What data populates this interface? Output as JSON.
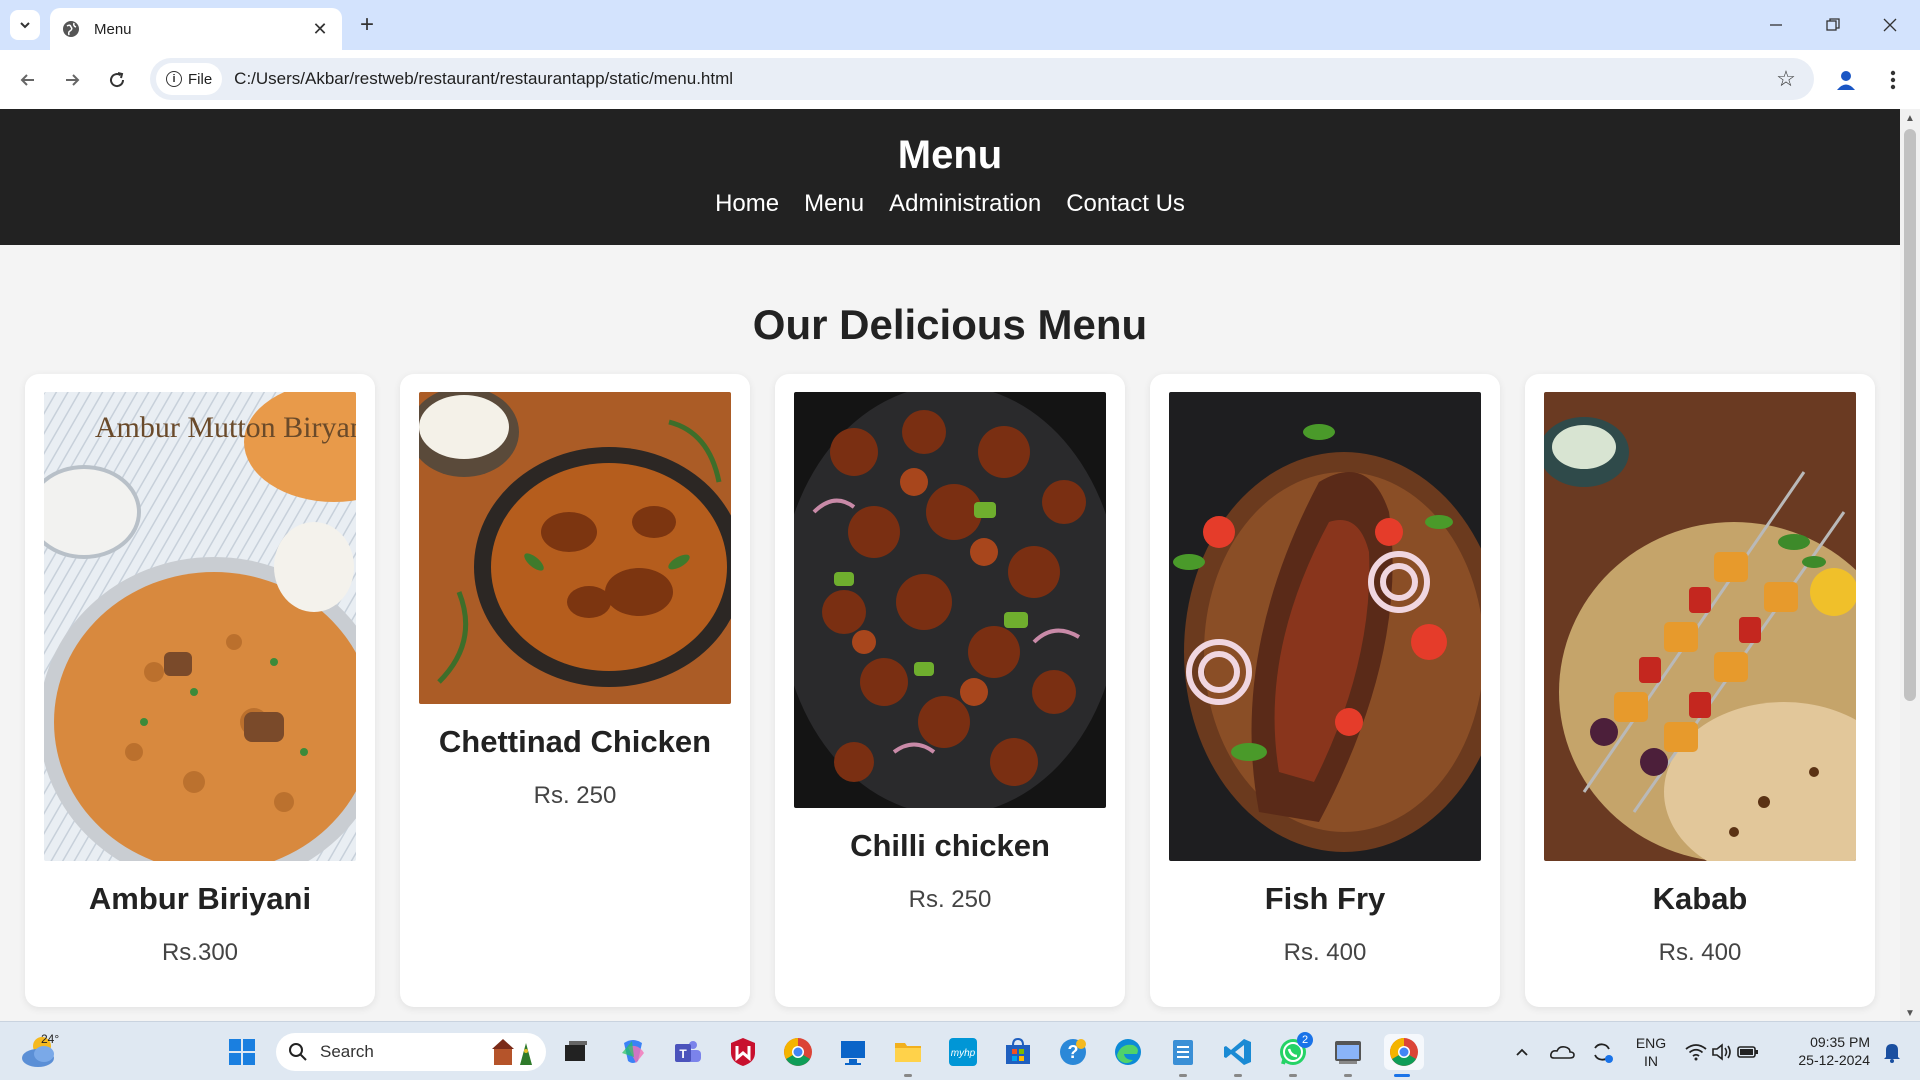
{
  "browser": {
    "tab_title": "Menu",
    "site_chip_label": "File",
    "url": "C:/Users/Akbar/restweb/restaurant/restaurantapp/static/menu.html"
  },
  "page": {
    "title": "Menu",
    "nav": [
      "Home",
      "Menu",
      "Administration",
      "Contact Us"
    ],
    "section_title": "Our Delicious Menu",
    "items": [
      {
        "name": "Ambur Biriyani",
        "price": "Rs.300",
        "image_caption": "Ambur Mutton Biryani"
      },
      {
        "name": "Chettinad Chicken",
        "price": "Rs. 250"
      },
      {
        "name": "Chilli chicken",
        "price": "Rs. 250"
      },
      {
        "name": "Fish Fry",
        "price": "Rs. 400"
      },
      {
        "name": "Kabab",
        "price": "Rs. 400"
      }
    ]
  },
  "taskbar": {
    "weather_temp": "24°",
    "search_label": "Search",
    "whatsapp_badge": "2",
    "language_line1": "ENG",
    "language_line2": "IN",
    "time": "09:35 PM",
    "date": "25-12-2024"
  },
  "colors": {
    "tabstrip": "#d3e3fd",
    "header_bg": "#222222",
    "page_bg": "#f4f4f4"
  }
}
